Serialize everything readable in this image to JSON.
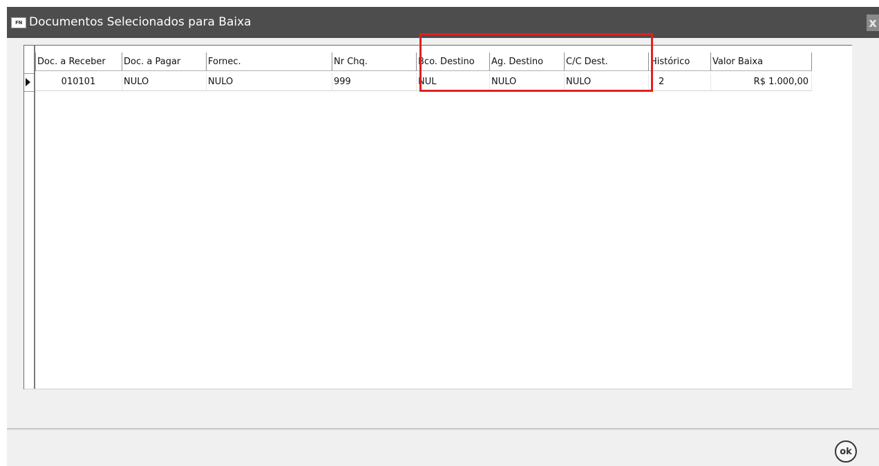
{
  "window": {
    "icon_text": "FN",
    "title": "Documentos Selecionados para Baixa",
    "close_label": "x"
  },
  "grid": {
    "columns": [
      {
        "label": "Doc. a Receber"
      },
      {
        "label": "Doc. a Pagar"
      },
      {
        "label": "Fornec."
      },
      {
        "label": "Nr Chq."
      },
      {
        "label": "Bco. Destino"
      },
      {
        "label": "Ag. Destino"
      },
      {
        "label": "C/C Dest."
      },
      {
        "label": "Histórico"
      },
      {
        "label": "Valor Baixa"
      }
    ],
    "rows": [
      {
        "cells": [
          "010101",
          "NULO",
          "NULO",
          "999",
          "NUL",
          "NULO",
          "NULO",
          "2",
          "R$ 1.000,00"
        ]
      }
    ]
  },
  "footer": {
    "ok_label": "ok"
  },
  "colors": {
    "titlebar": "#4d4d4d",
    "highlight": "#e02020"
  }
}
